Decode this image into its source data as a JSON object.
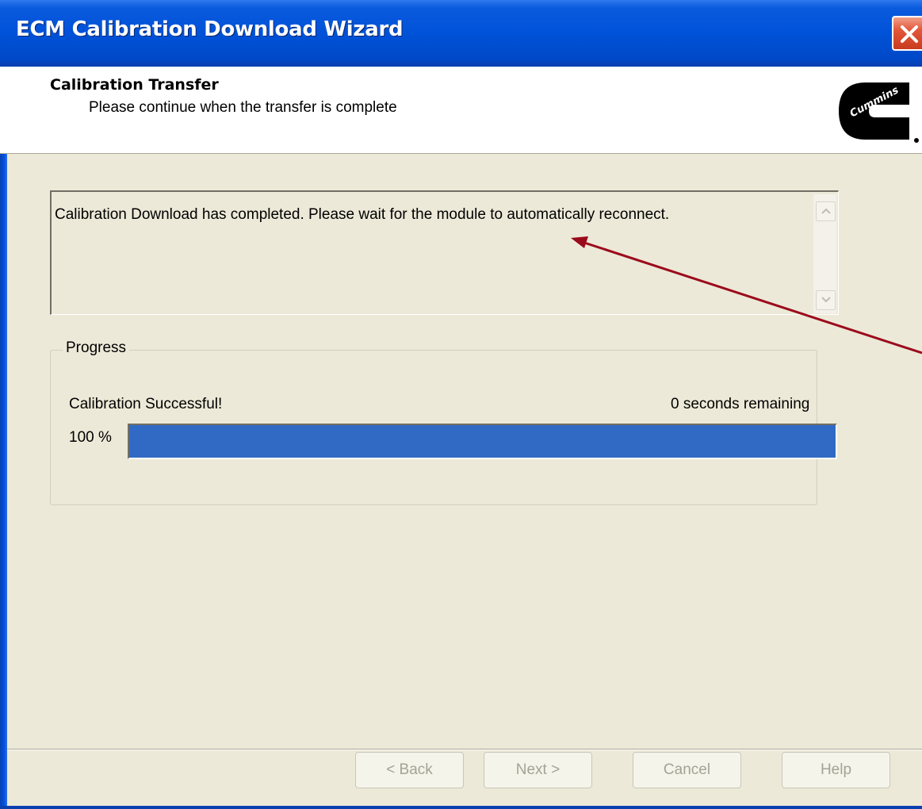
{
  "window": {
    "title": "ECM Calibration Download Wizard"
  },
  "header": {
    "title": "Calibration Transfer",
    "subtitle": "Please continue when the transfer is complete",
    "logo_text": "Cummins"
  },
  "message": {
    "text": "Calibration Download has completed. Please wait for the module to automatically reconnect."
  },
  "progress": {
    "group_label": "Progress",
    "status": "Calibration Successful!",
    "remaining": "0 seconds remaining",
    "percent_label": "100 %",
    "fraction": 1.0,
    "fill_color": "#316ac5"
  },
  "buttons": {
    "back": "< Back",
    "next": "Next >",
    "cancel": "Cancel",
    "help": "Help"
  },
  "colors": {
    "annotation_arrow": "#9b0a1c",
    "titlebar": "#0054e3",
    "dialog_bg": "#ece9d8"
  }
}
